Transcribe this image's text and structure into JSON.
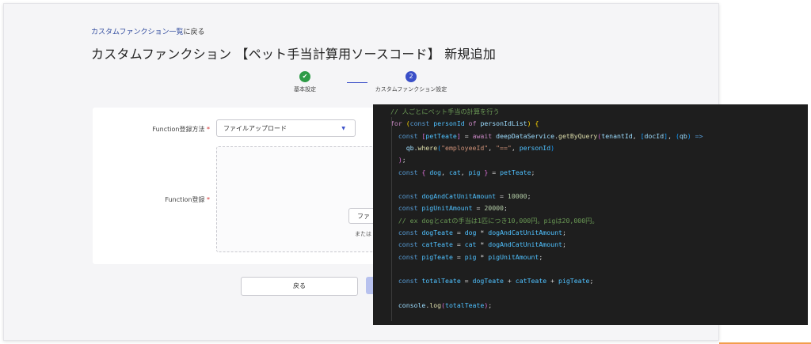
{
  "breadcrumb": {
    "link": "カスタムファンクション一覧",
    "suffix": "に戻る"
  },
  "page_title": "カスタムファンクション 【ペット手当計算用ソースコード】 新規追加",
  "stepper": {
    "step1": {
      "icon": "✔",
      "label": "基本設定"
    },
    "step2": {
      "number": "2",
      "label": "カスタムファンクション設定"
    }
  },
  "form": {
    "method_label": "Function登録方法",
    "method_required": "*",
    "method_value": "ファイルアップロード",
    "function_label": "Function登録",
    "function_required": "*",
    "file_button": "ファ",
    "or_text": "または"
  },
  "actions": {
    "back": "戻る"
  },
  "code_lines": [
    [
      [
        "// 人ごとにペット手当の計算を行う",
        "c-cm"
      ]
    ],
    [
      [
        "for",
        "c-kw"
      ],
      [
        " ",
        "c-pn"
      ],
      [
        "(",
        "c-b1"
      ],
      [
        "const",
        "c-st"
      ],
      [
        " ",
        "c-pn"
      ],
      [
        "personId",
        "c-cn"
      ],
      [
        " ",
        "c-pn"
      ],
      [
        "of",
        "c-kw"
      ],
      [
        " ",
        "c-pn"
      ],
      [
        "personIdList",
        "c-vr"
      ],
      [
        ")",
        "c-b1"
      ],
      [
        " ",
        "c-pn"
      ],
      [
        "{",
        "c-b1"
      ]
    ],
    [
      [
        "  ",
        "c-pn"
      ],
      [
        "const",
        "c-st"
      ],
      [
        " ",
        "c-pn"
      ],
      [
        "[",
        "c-b2"
      ],
      [
        "petTeate",
        "c-cn"
      ],
      [
        "]",
        "c-b2"
      ],
      [
        " = ",
        "c-pn"
      ],
      [
        "await",
        "c-kw"
      ],
      [
        " ",
        "c-pn"
      ],
      [
        "deepDataService",
        "c-vr"
      ],
      [
        ".",
        "c-pn"
      ],
      [
        "getByQuery",
        "c-fn"
      ],
      [
        "(",
        "c-b2"
      ],
      [
        "tenantId",
        "c-vr"
      ],
      [
        ", ",
        "c-pn"
      ],
      [
        "[",
        "c-b3"
      ],
      [
        "docId",
        "c-vr"
      ],
      [
        "]",
        "c-b3"
      ],
      [
        ", ",
        "c-pn"
      ],
      [
        "(",
        "c-b3"
      ],
      [
        "qb",
        "c-vr"
      ],
      [
        ")",
        "c-b3"
      ],
      [
        " ",
        "c-pn"
      ],
      [
        "=>",
        "c-st"
      ]
    ],
    [
      [
        "    ",
        "c-pn"
      ],
      [
        "qb",
        "c-vr"
      ],
      [
        ".",
        "c-pn"
      ],
      [
        "where",
        "c-fn"
      ],
      [
        "(",
        "c-b3"
      ],
      [
        "\"employeeId\"",
        "c-str"
      ],
      [
        ", ",
        "c-pn"
      ],
      [
        "\"==\"",
        "c-str"
      ],
      [
        ", ",
        "c-pn"
      ],
      [
        "personId",
        "c-cn"
      ],
      [
        ")",
        "c-b3"
      ]
    ],
    [
      [
        "  ",
        "c-pn"
      ],
      [
        ")",
        "c-b2"
      ],
      [
        ";",
        "c-pn"
      ]
    ],
    [
      [
        "  ",
        "c-pn"
      ],
      [
        "const",
        "c-st"
      ],
      [
        " ",
        "c-pn"
      ],
      [
        "{",
        "c-b2"
      ],
      [
        " ",
        "c-pn"
      ],
      [
        "dog",
        "c-cn"
      ],
      [
        ", ",
        "c-pn"
      ],
      [
        "cat",
        "c-cn"
      ],
      [
        ", ",
        "c-pn"
      ],
      [
        "pig",
        "c-cn"
      ],
      [
        " ",
        "c-pn"
      ],
      [
        "}",
        "c-b2"
      ],
      [
        " = ",
        "c-pn"
      ],
      [
        "petTeate",
        "c-cn"
      ],
      [
        ";",
        "c-pn"
      ]
    ],
    [],
    [
      [
        "  ",
        "c-pn"
      ],
      [
        "const",
        "c-st"
      ],
      [
        " ",
        "c-pn"
      ],
      [
        "dogAndCatUnitAmount",
        "c-cn"
      ],
      [
        " = ",
        "c-pn"
      ],
      [
        "10000",
        "c-num"
      ],
      [
        ";",
        "c-pn"
      ]
    ],
    [
      [
        "  ",
        "c-pn"
      ],
      [
        "const",
        "c-st"
      ],
      [
        " ",
        "c-pn"
      ],
      [
        "pigUnitAmount",
        "c-cn"
      ],
      [
        " = ",
        "c-pn"
      ],
      [
        "20000",
        "c-num"
      ],
      [
        ";",
        "c-pn"
      ]
    ],
    [
      [
        "  // ex dogとcatの手当は1匹につき10,000円。pigは20,000円。",
        "c-cm"
      ]
    ],
    [
      [
        "  ",
        "c-pn"
      ],
      [
        "const",
        "c-st"
      ],
      [
        " ",
        "c-pn"
      ],
      [
        "dogTeate",
        "c-cn"
      ],
      [
        " = ",
        "c-pn"
      ],
      [
        "dog",
        "c-cn"
      ],
      [
        " * ",
        "c-pn"
      ],
      [
        "dogAndCatUnitAmount",
        "c-cn"
      ],
      [
        ";",
        "c-pn"
      ]
    ],
    [
      [
        "  ",
        "c-pn"
      ],
      [
        "const",
        "c-st"
      ],
      [
        " ",
        "c-pn"
      ],
      [
        "catTeate",
        "c-cn"
      ],
      [
        " = ",
        "c-pn"
      ],
      [
        "cat",
        "c-cn"
      ],
      [
        " * ",
        "c-pn"
      ],
      [
        "dogAndCatUnitAmount",
        "c-cn"
      ],
      [
        ";",
        "c-pn"
      ]
    ],
    [
      [
        "  ",
        "c-pn"
      ],
      [
        "const",
        "c-st"
      ],
      [
        " ",
        "c-pn"
      ],
      [
        "pigTeate",
        "c-cn"
      ],
      [
        " = ",
        "c-pn"
      ],
      [
        "pig",
        "c-cn"
      ],
      [
        " * ",
        "c-pn"
      ],
      [
        "pigUnitAmount",
        "c-cn"
      ],
      [
        ";",
        "c-pn"
      ]
    ],
    [],
    [
      [
        "  ",
        "c-pn"
      ],
      [
        "const",
        "c-st"
      ],
      [
        " ",
        "c-pn"
      ],
      [
        "totalTeate",
        "c-cn"
      ],
      [
        " = ",
        "c-pn"
      ],
      [
        "dogTeate",
        "c-cn"
      ],
      [
        " + ",
        "c-pn"
      ],
      [
        "catTeate",
        "c-cn"
      ],
      [
        " + ",
        "c-pn"
      ],
      [
        "pigTeate",
        "c-cn"
      ],
      [
        ";",
        "c-pn"
      ]
    ],
    [],
    [
      [
        "  ",
        "c-pn"
      ],
      [
        "console",
        "c-vr"
      ],
      [
        ".",
        "c-pn"
      ],
      [
        "log",
        "c-fn"
      ],
      [
        "(",
        "c-b2"
      ],
      [
        "totalTeate",
        "c-cn"
      ],
      [
        ")",
        "c-b2"
      ],
      [
        ";",
        "c-pn"
      ]
    ]
  ],
  "colors": {
    "accent": "#3a4fc8",
    "success": "#2e9b47",
    "required": "#d32f2f",
    "editor_bg": "#1e1e1e"
  }
}
